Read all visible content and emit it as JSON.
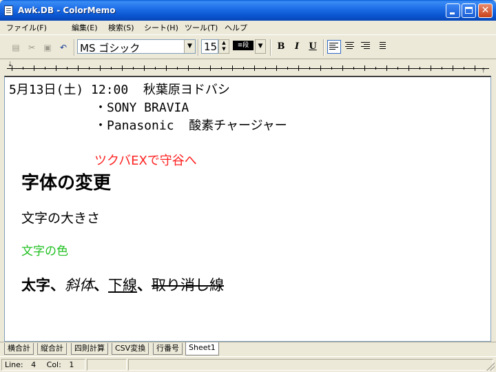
{
  "window": {
    "title": "Awk.DB - ColorMemo",
    "minimize_glyph": "_",
    "close_glyph": "✕"
  },
  "menu": [
    "ファイル(F)",
    "編集(E)",
    "検索(S)",
    "シート(H)",
    "ツール(T)",
    "ヘルプ"
  ],
  "toolbar": {
    "font_name": "MS ゴシック",
    "font_size": "15",
    "paragraph_style": "≡段",
    "bold_label": "B",
    "italic_label": "I",
    "underline_label": "U",
    "dropdown_glyph": "▼",
    "spin_up_glyph": "▲",
    "spin_down_glyph": "▼",
    "icons": [
      "copy-icon",
      "cut-icon",
      "paste-icon",
      "undo-icon",
      "align-left-icon",
      "align-center-icon",
      "align-right-icon",
      "bullet-list-icon"
    ]
  },
  "ruler": {
    "left_marker": "⇣",
    "right_marker": "⇡"
  },
  "document": {
    "lines": [
      {
        "text": "5月13日(土) 12:00  秋葉原ヨドバシ",
        "color": "#000000"
      },
      {
        "text": "・SONY BRAVIA",
        "color": "#000000"
      },
      {
        "text": "・Panasonic  酸素チャージャー",
        "color": "#000000"
      },
      {
        "text": "ツクバEXで守谷へ",
        "color": "#ff2020"
      },
      {
        "text": "字体の変更",
        "color": "#000000"
      },
      {
        "text": "文字の大きさ",
        "color": "#000000"
      },
      {
        "text": "文字の色",
        "color": "#20c020"
      }
    ],
    "last_line": {
      "bold": "太字",
      "sep1": "、",
      "italic": "斜体",
      "sep2": "、",
      "underline": "下線",
      "sep3": "、",
      "strike": "取り消し線"
    }
  },
  "sheet_tabs": [
    "横合計",
    "縦合計",
    "四則計算",
    "CSV変換",
    "行番号",
    "Sheet1"
  ],
  "active_tab": "Sheet1",
  "status": {
    "line_label": "Line:",
    "line_value": "4",
    "col_label": "Col:",
    "col_value": "1"
  }
}
